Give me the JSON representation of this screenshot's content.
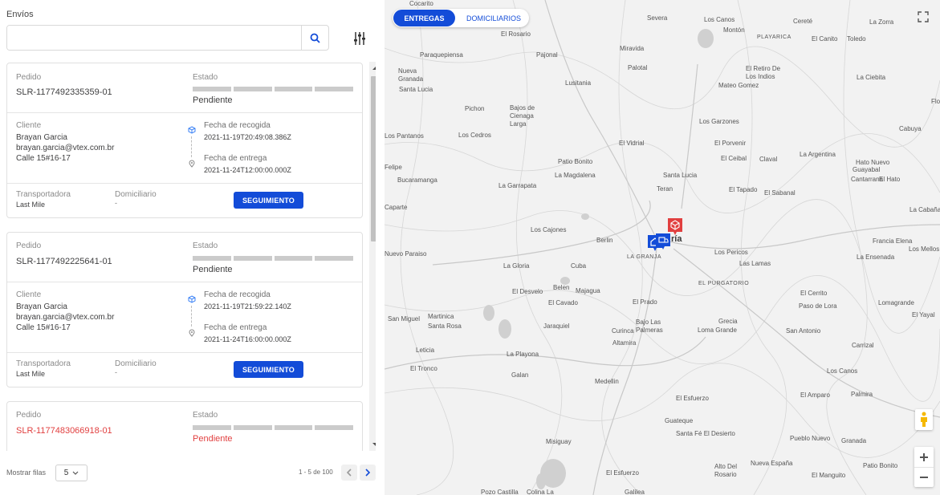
{
  "panel": {
    "title": "Envíos",
    "search_placeholder": ""
  },
  "icons": {
    "search": "search-icon",
    "filter": "sliders-icon",
    "pickup": "box-icon",
    "delivery": "location-pin-icon"
  },
  "colors": {
    "accent": "#134cd8",
    "error": "#e13f3f",
    "bar": "#cbcbcb"
  },
  "labels": {
    "pedido": "Pedido",
    "estado": "Estado",
    "cliente": "Cliente",
    "recogida": "Fecha de recogida",
    "entrega": "Fecha de entrega",
    "transportadora": "Transportadora",
    "domiciliario": "Domiciliario",
    "seguimiento": "SEGUIMIENTO"
  },
  "orders": [
    {
      "id": "SLR-1177492335359-01",
      "status": "Pendiente",
      "client_name": "Brayan Garcia",
      "client_email": "brayan.garcia@vtex.com.br",
      "client_address": "Calle 15#16-17",
      "pickup_date": "2021-11-19T20:49:08.386Z",
      "delivery_date": "2021-11-24T12:00:00.000Z",
      "carrier": "Last Mile",
      "courier": "-"
    },
    {
      "id": "SLR-1177492225641-01",
      "status": "Pendiente",
      "client_name": "Brayan Garcia",
      "client_email": "brayan.garcia@vtex.com.br",
      "client_address": "Calle 15#16-17",
      "pickup_date": "2021-11-19T21:59:22.140Z",
      "delivery_date": "2021-11-24T16:00:00.000Z",
      "carrier": "Last Mile",
      "courier": "-"
    },
    {
      "id": "SLR-1177483066918-01",
      "status": "Pendiente"
    }
  ],
  "pagination": {
    "rows_label": "Mostrar filas",
    "rows_value": "5",
    "range": "1 - 5 de 100"
  },
  "map": {
    "tabs": [
      "ENTREGAS",
      "DOMICILIARIOS"
    ],
    "active_tab": "ENTREGAS",
    "places": [
      "Cocarito",
      "Severa",
      "Los Canos",
      "Cereté",
      "La Zorra",
      "Montón",
      "El Rosario",
      "PLAYARICA",
      "El Canito",
      "Toledo",
      "Paraquepiensa",
      "Pajonal",
      "Miravida",
      "Nueva Granada",
      "Santa Lucia",
      "Palotal",
      "El Retiro De Los Indios",
      "La Ciebita",
      "Lusitania",
      "Mateo Gomez",
      "Florida",
      "Pichon",
      "Bajos de Cienaga Larga",
      "Los Garzones",
      "Cabuya",
      "Los Pantanos",
      "Los Cedros",
      "El Vidrial",
      "El Porvenir",
      "Patio Bonito",
      "El Ceibal",
      "Claval",
      "La Argentina",
      "Hato Nuevo",
      "Guayabal",
      "Felipe",
      "La Magdalena",
      "Cantarrana",
      "El Hato",
      "Bucaramanga",
      "Santa Lucia",
      "La Garrapata",
      "Teran",
      "El Tapado",
      "El Sabanal",
      "Caparte",
      "La Cabaña",
      "Los Cajones",
      "Berlin",
      "Francia Elena",
      "Nuevo Paraiso",
      "Los Pericos",
      "Los Mellos",
      "La Ensenada",
      "La Gloria",
      "Cuba",
      "LA GRANJA",
      "Las Lamas",
      "EL PURGATORIO",
      "El Desvelo",
      "Belen",
      "Majagua",
      "El Cerrito",
      "Paso de Lora",
      "El Cavado",
      "El Prado",
      "Lomagrande",
      "San Miguel",
      "Martinica",
      "Santa Rosa",
      "Jaraquiel",
      "Bajo Las Palmeras",
      "Grecia",
      "Loma Grande",
      "San Antonio",
      "El Yayal",
      "Curinca",
      "Altamira",
      "Carrizal",
      "Leticia",
      "La Playona",
      "El Tronco",
      "Galan",
      "Los Canos",
      "Medellin",
      "El Amparo",
      "Palmira",
      "El Esfuerzo",
      "Guateque",
      "Santa Fé El Desierto",
      "Pueblo Nuevo",
      "Granada",
      "Misiguay",
      "Alto Del Rosario",
      "Nueva España",
      "Patio Bonito",
      "El Esfuerzo",
      "El Manguito",
      "Pozo Castilla",
      "Colina La",
      "Galilea"
    ],
    "city_label": "ría"
  }
}
